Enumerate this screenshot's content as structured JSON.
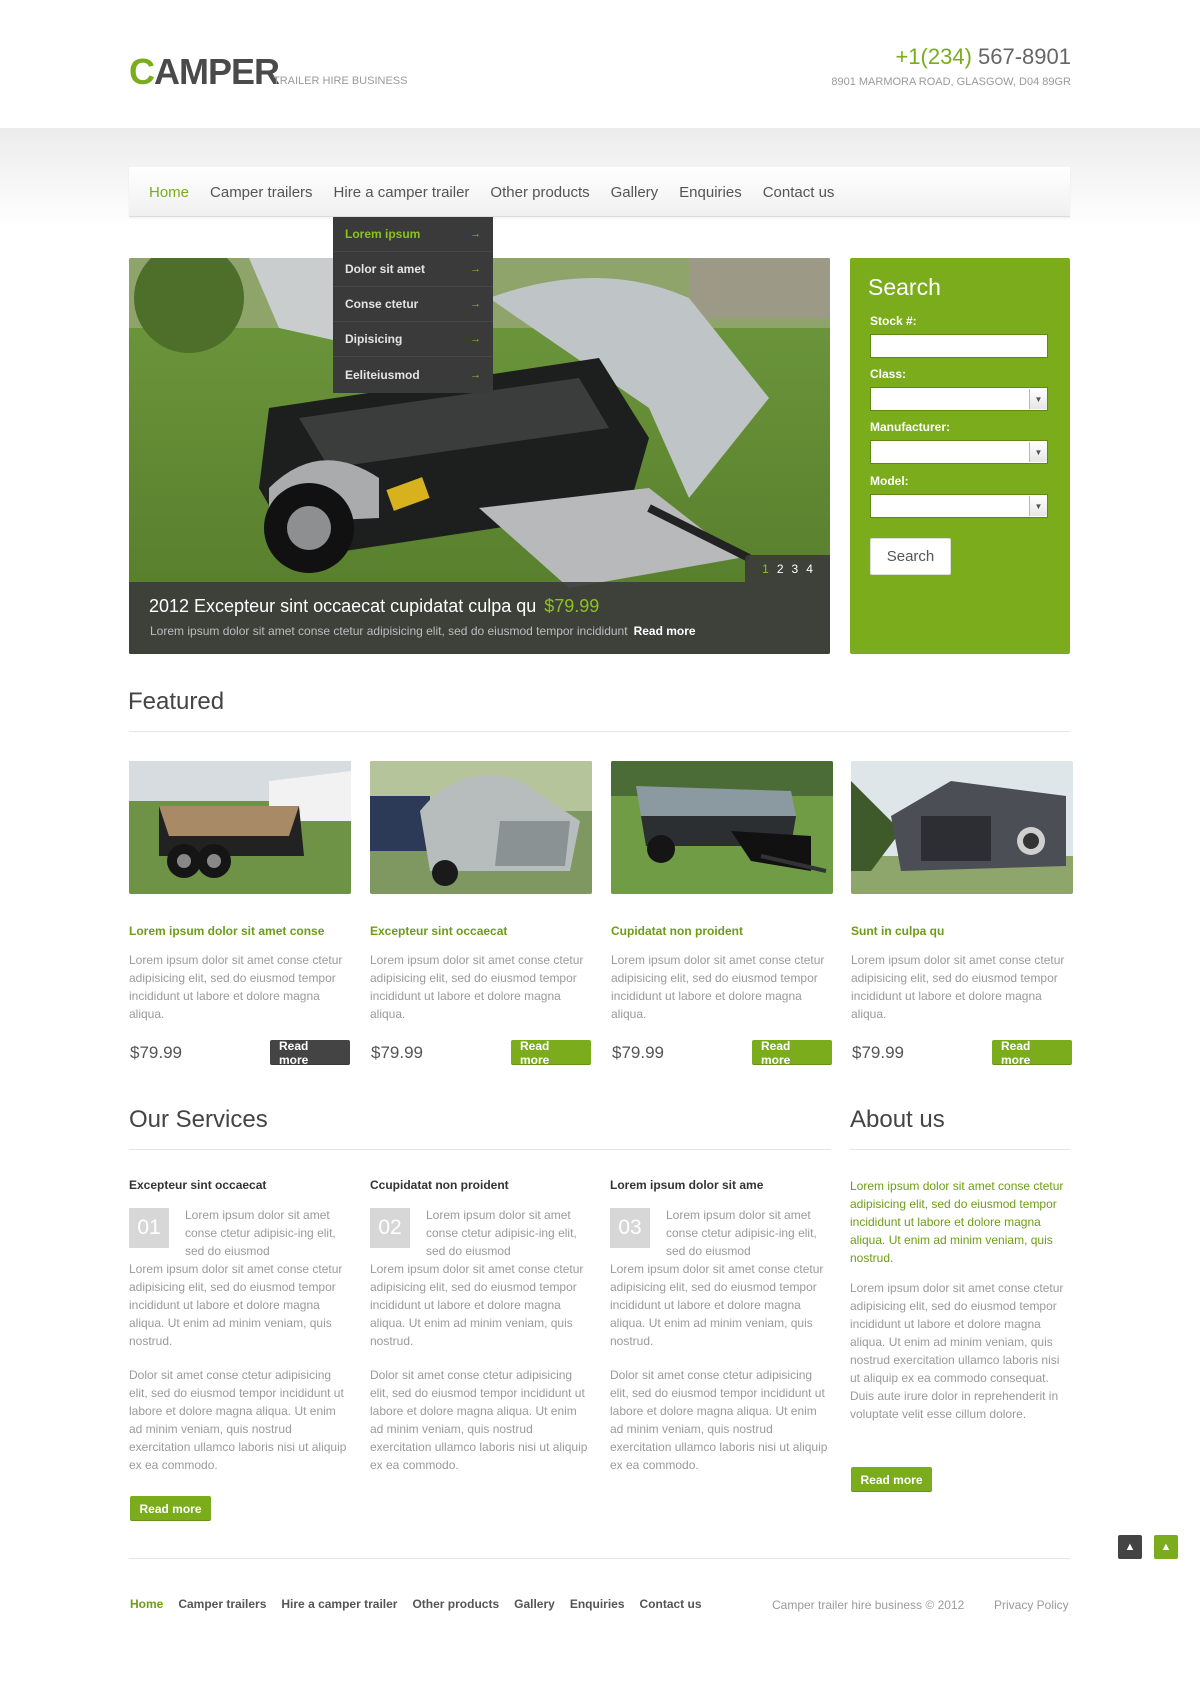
{
  "header": {
    "logo_first": "C",
    "logo_rest": "AMPER",
    "tagline": "TRAILER HIRE BUSINESS",
    "phone_prefix": "+1(234)",
    "phone_rest": " 567-8901",
    "address": "8901 MARMORA ROAD, GLASGOW,  D04 89GR"
  },
  "nav": {
    "items": [
      "Home",
      "Camper trailers",
      "Hire a camper trailer",
      "Other products",
      "Gallery",
      "Enquiries",
      "Contact us"
    ]
  },
  "dropdown": {
    "items": [
      "Lorem ipsum",
      "Dolor sit amet",
      "Conse ctetur",
      "Dipisicing",
      "Eeliteiusmod"
    ]
  },
  "slider": {
    "title": "2012 Excepteur sint occaecat cupidatat culpa qu",
    "price": "$79.99",
    "text": "Lorem ipsum dolor sit amet conse ctetur adipisicing elit, sed do eiusmod tempor incididunt",
    "read_more": "Read more",
    "pages": [
      "1",
      "2",
      "3",
      "4"
    ]
  },
  "search": {
    "title": "Search",
    "stock_label": "Stock #:",
    "class_label": "Class:",
    "manufacturer_label": "Manufacturer:",
    "model_label": "Model:",
    "button": "Search"
  },
  "featured": {
    "heading": "Featured",
    "items": [
      {
        "title": "Lorem ipsum dolor sit amet conse",
        "text": "Lorem ipsum dolor sit amet conse ctetur adipisicing elit, sed do eiusmod tempor incididunt ut labore et dolore magna aliqua.",
        "price": "$79.99",
        "button": "Read more"
      },
      {
        "title": "Excepteur sint occaecat",
        "text": "Lorem ipsum dolor sit amet conse ctetur adipisicing elit, sed do eiusmod tempor incididunt ut labore et dolore magna aliqua.",
        "price": "$79.99",
        "button": "Read more"
      },
      {
        "title": "Cupidatat non proident",
        "text": "Lorem ipsum dolor sit amet conse ctetur adipisicing elit, sed do eiusmod tempor incididunt ut labore et dolore magna aliqua.",
        "price": "$79.99",
        "button": "Read more"
      },
      {
        "title": "Sunt in culpa qu",
        "text": "Lorem ipsum dolor sit amet conse ctetur adipisicing elit, sed do eiusmod tempor incididunt ut labore et dolore magna aliqua.",
        "price": "$79.99",
        "button": "Read more"
      }
    ]
  },
  "services": {
    "heading": "Our Services",
    "items": [
      {
        "title": "Excepteur sint occaecat",
        "num": "01",
        "intro": "Lorem ipsum dolor sit amet conse ctetur adipisic-ing elit, sed do eiusmod",
        "body1": "Lorem ipsum dolor sit amet conse ctetur adipisicing elit, sed do eiusmod tempor incididunt ut labore et dolore magna aliqua. Ut enim ad minim veniam, quis nostrud.",
        "body2": "Dolor sit amet conse ctetur adipisicing elit, sed do eiusmod tempor incididunt ut labore et dolore magna aliqua. Ut enim ad minim veniam, quis nostrud exercitation ullamco laboris nisi ut aliquip ex ea commodo."
      },
      {
        "title": "Ccupidatat non proident",
        "num": "02",
        "intro": "Lorem ipsum dolor sit amet conse ctetur adipisic-ing elit, sed do eiusmod",
        "body1": "Lorem ipsum dolor sit amet conse ctetur adipisicing elit, sed do eiusmod tempor incididunt ut labore et dolore magna aliqua. Ut enim ad minim veniam, quis nostrud.",
        "body2": "Dolor sit amet conse ctetur adipisicing elit, sed do eiusmod tempor incididunt ut labore et dolore magna aliqua. Ut enim ad minim veniam, quis nostrud exercitation ullamco laboris nisi ut aliquip ex ea commodo."
      },
      {
        "title": "Lorem ipsum dolor sit ame",
        "num": "03",
        "intro": "Lorem ipsum dolor sit amet conse ctetur adipisic-ing elit, sed do eiusmod",
        "body1": "Lorem ipsum dolor sit amet conse ctetur adipisicing elit, sed do eiusmod tempor incididunt ut labore et dolore magna aliqua. Ut enim ad minim veniam, quis nostrud.",
        "body2": "Dolor sit amet conse ctetur adipisicing elit, sed do eiusmod tempor incididunt ut labore et dolore magna aliqua. Ut enim ad minim veniam, quis nostrud exercitation ullamco laboris nisi ut aliquip ex ea commodo."
      }
    ],
    "button": "Read more"
  },
  "about": {
    "heading": "About us",
    "green_text": "Lorem ipsum dolor sit amet conse ctetur adipisicing elit, sed do eiusmod tempor incididunt ut labore et dolore magna aliqua. Ut enim ad minim veniam, quis nostrud.",
    "text": "Lorem ipsum dolor sit amet conse ctetur adipisicing elit, sed do eiusmod tempor incididunt ut labore et dolore magna aliqua. Ut enim ad minim veniam, quis nostrud exercitation ullamco laboris nisi ut aliquip ex ea commodo consequat. Duis aute irure dolor in reprehenderit in voluptate velit esse cillum dolore.",
    "button": "Read more"
  },
  "footer": {
    "nav": [
      "Home",
      "Camper trailers",
      "Hire a camper trailer",
      "Other products",
      "Gallery",
      "Enquiries",
      "Contact us"
    ],
    "copyright": "Camper trailer hire business  © 2012",
    "privacy": "Privacy Policy"
  },
  "icons": {
    "dropdown_arrow": "→",
    "select_caret": "▼",
    "scroll_up": "▲"
  },
  "colors": {
    "accent": "#7aac1c",
    "dark": "#444444"
  }
}
